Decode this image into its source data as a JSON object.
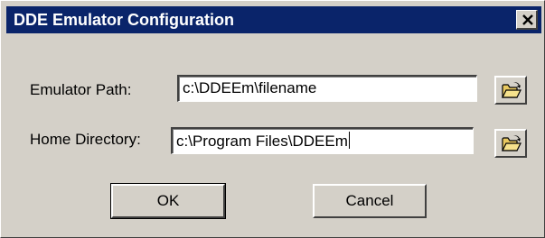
{
  "window": {
    "title": "DDE Emulator Configuration",
    "close_symbol": "×"
  },
  "form": {
    "emulator_path": {
      "label": "Emulator Path:",
      "value": "c:\\DDEEm\\filename",
      "browse_icon": "open-folder-icon"
    },
    "home_directory": {
      "label": "Home Directory:",
      "value": "c:\\Program Files\\DDEEm",
      "browse_icon": "open-folder-icon"
    }
  },
  "buttons": {
    "ok_label": "OK",
    "cancel_label": "Cancel"
  },
  "colors": {
    "titlebar": "#0a246a",
    "face": "#d4d0c8",
    "folder": "#e8c860"
  }
}
